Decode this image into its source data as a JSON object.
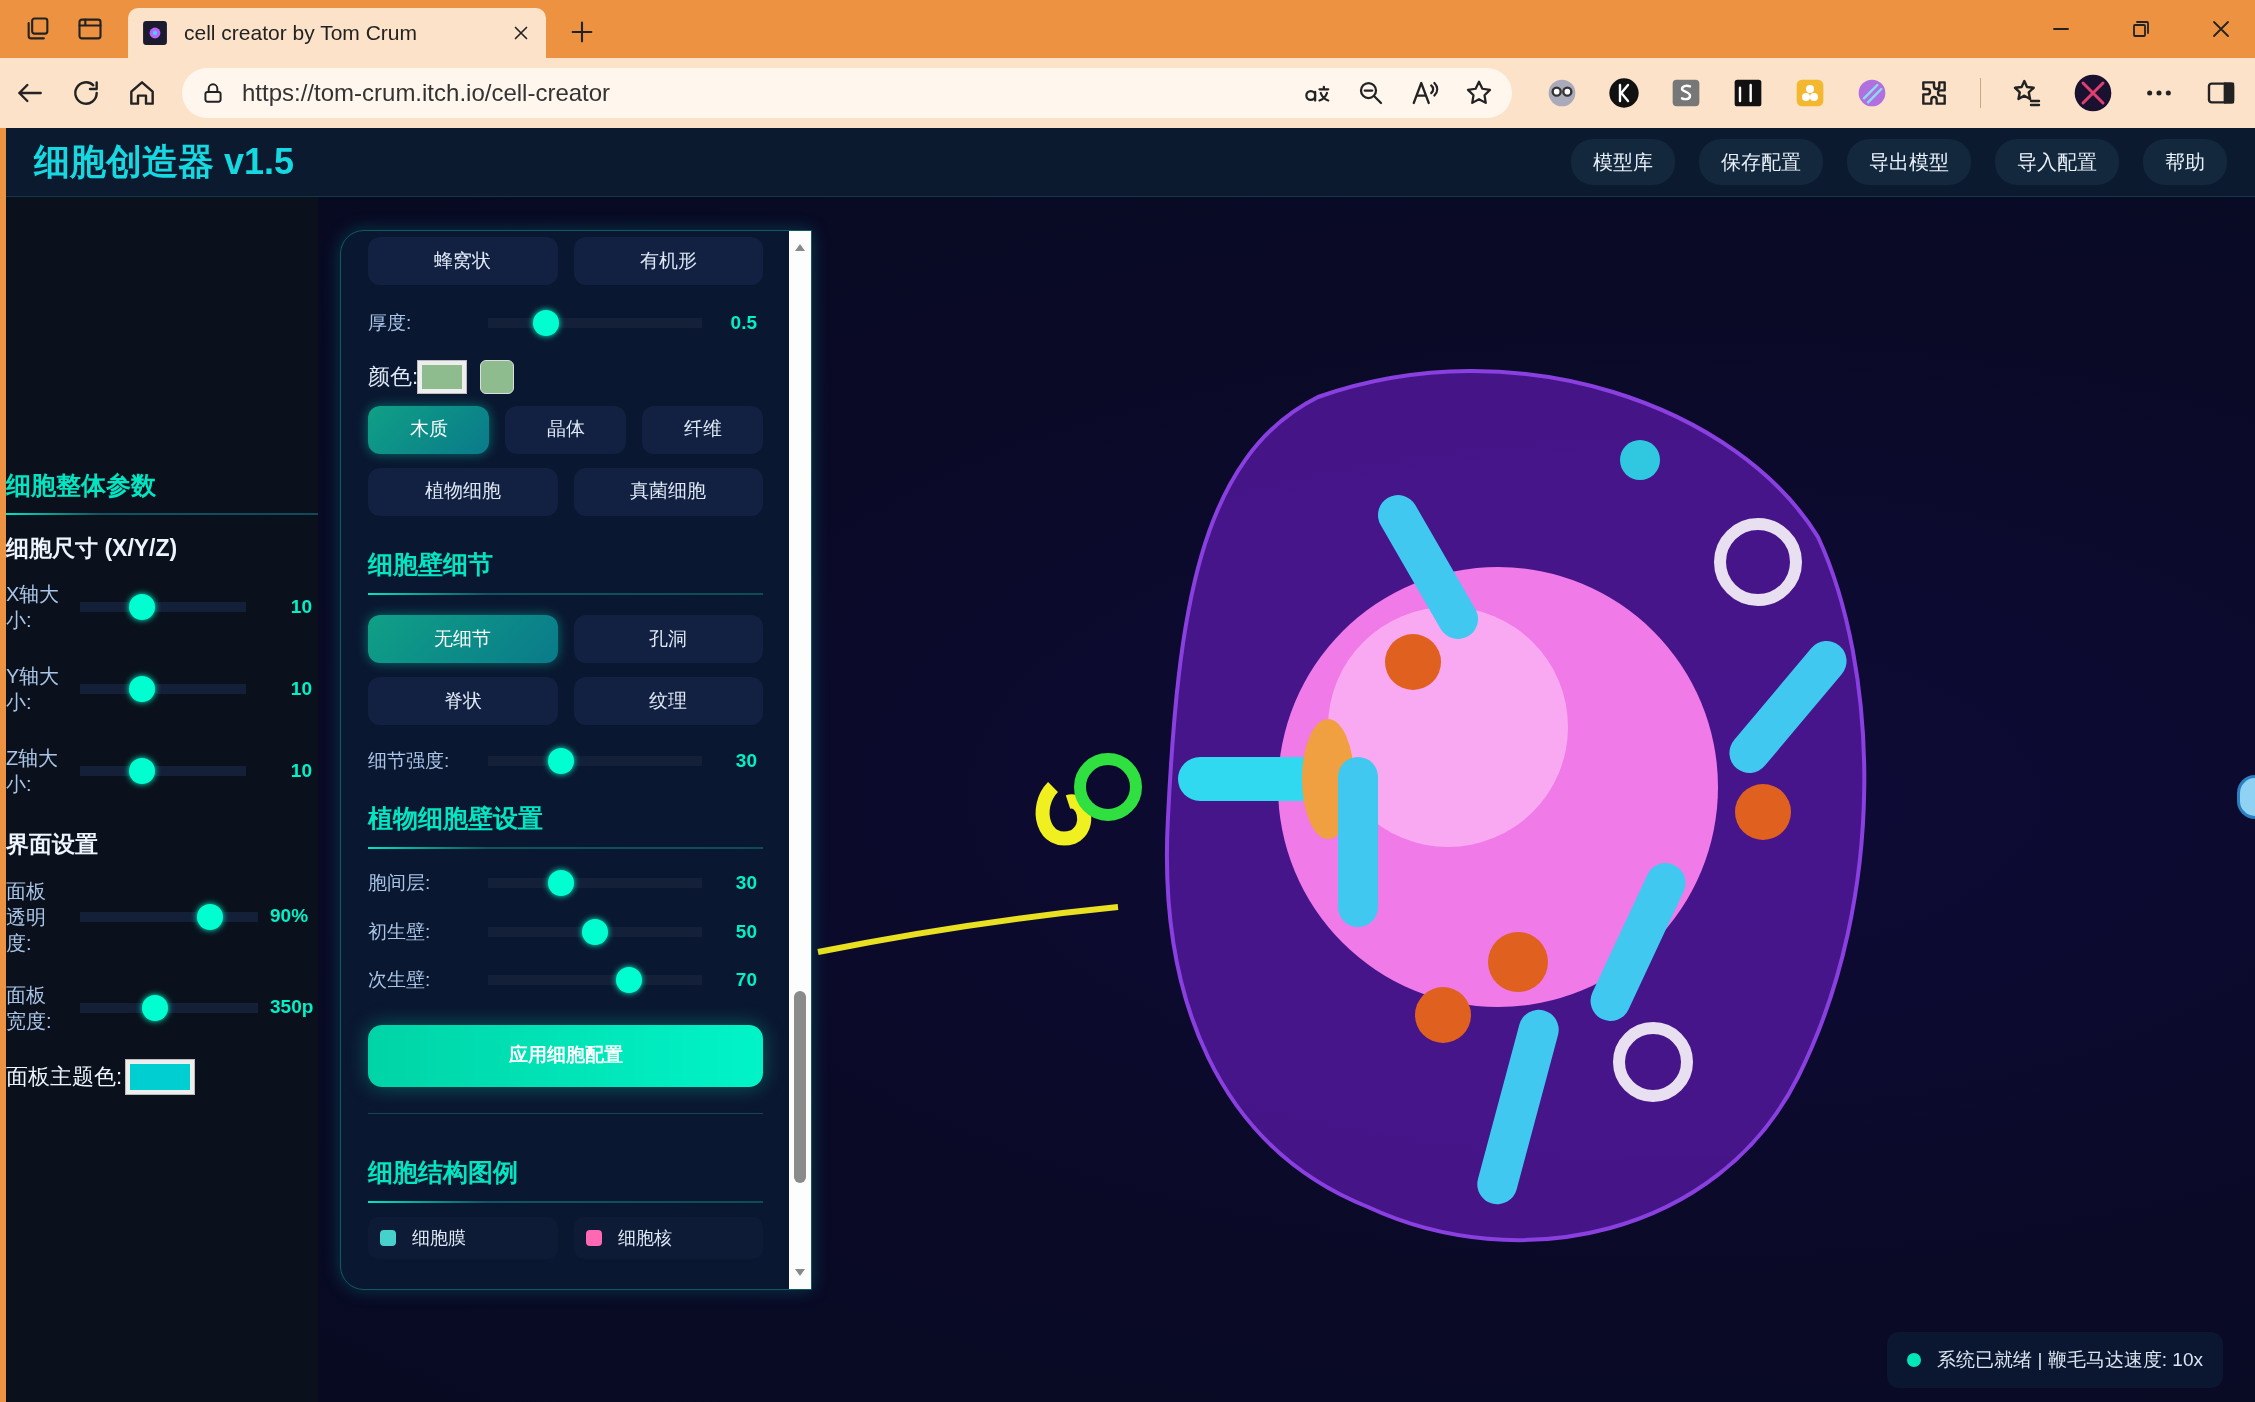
{
  "browser": {
    "tab_title": "cell creator by Tom Crum",
    "url": "https://tom-crum.itch.io/cell-creator"
  },
  "app": {
    "title": "细胞创造器 v1.5",
    "nav_buttons": [
      "模型库",
      "保存配置",
      "导出模型",
      "导入配置",
      "帮助"
    ]
  },
  "sidebar": {
    "section_title": "细胞整体参数",
    "size_title": "细胞尺寸 (X/Y/Z)",
    "size_sliders": [
      {
        "label": "X轴大小:",
        "level": 0.35,
        "reading": "10"
      },
      {
        "label": "Y轴大小:",
        "level": 0.35,
        "reading": "10"
      },
      {
        "label": "Z轴大小:",
        "level": 0.35,
        "reading": "10"
      }
    ],
    "ui_title": "界面设置",
    "ui_sliders": [
      {
        "label": "面板透明度:",
        "level": 0.77,
        "reading": "90%"
      },
      {
        "label": "面板宽度:",
        "level": 0.41,
        "reading": "350p"
      }
    ],
    "theme_color": {
      "label": "面板主题色:",
      "color": "#00ced1"
    }
  },
  "panel": {
    "shape_buttons": [
      {
        "label": "蜂窝状",
        "selected": false
      },
      {
        "label": "有机形",
        "selected": false
      }
    ],
    "thickness": {
      "label": "厚度:",
      "level": 0.24,
      "reading": "0.5"
    },
    "color_field": {
      "label": "颜色:",
      "color": "#8fbc8f"
    },
    "material_buttons": [
      {
        "label": "木质",
        "selected": true
      },
      {
        "label": "晶体",
        "selected": false
      },
      {
        "label": "纤维",
        "selected": false
      }
    ],
    "cell_type_buttons": [
      {
        "label": "植物细胞",
        "selected": false
      },
      {
        "label": "真菌细胞",
        "selected": false
      }
    ],
    "detail_title": "细胞壁细节",
    "detail_buttons": [
      {
        "label": "无细节",
        "selected": true
      },
      {
        "label": "孔洞",
        "selected": false
      },
      {
        "label": "脊状",
        "selected": false
      },
      {
        "label": "纹理",
        "selected": false
      }
    ],
    "detail_strength": {
      "label": "细节强度:",
      "level": 0.32,
      "reading": "30"
    },
    "plant_title": "植物细胞壁设置",
    "plant_sliders": [
      {
        "label": "胞间层:",
        "level": 0.32,
        "reading": "30"
      },
      {
        "label": "初生壁:",
        "level": 0.5,
        "reading": "50"
      },
      {
        "label": "次生壁:",
        "level": 0.68,
        "reading": "70"
      }
    ],
    "apply_button": "应用细胞配置",
    "legend_title": "细胞结构图例",
    "legend": [
      {
        "label": "细胞膜",
        "color": "#48d1cc"
      },
      {
        "label": "细胞核",
        "color": "#ff69b4"
      }
    ]
  },
  "status": {
    "text": "系统已就绪 | 鞭毛马达速度: 10x"
  }
}
